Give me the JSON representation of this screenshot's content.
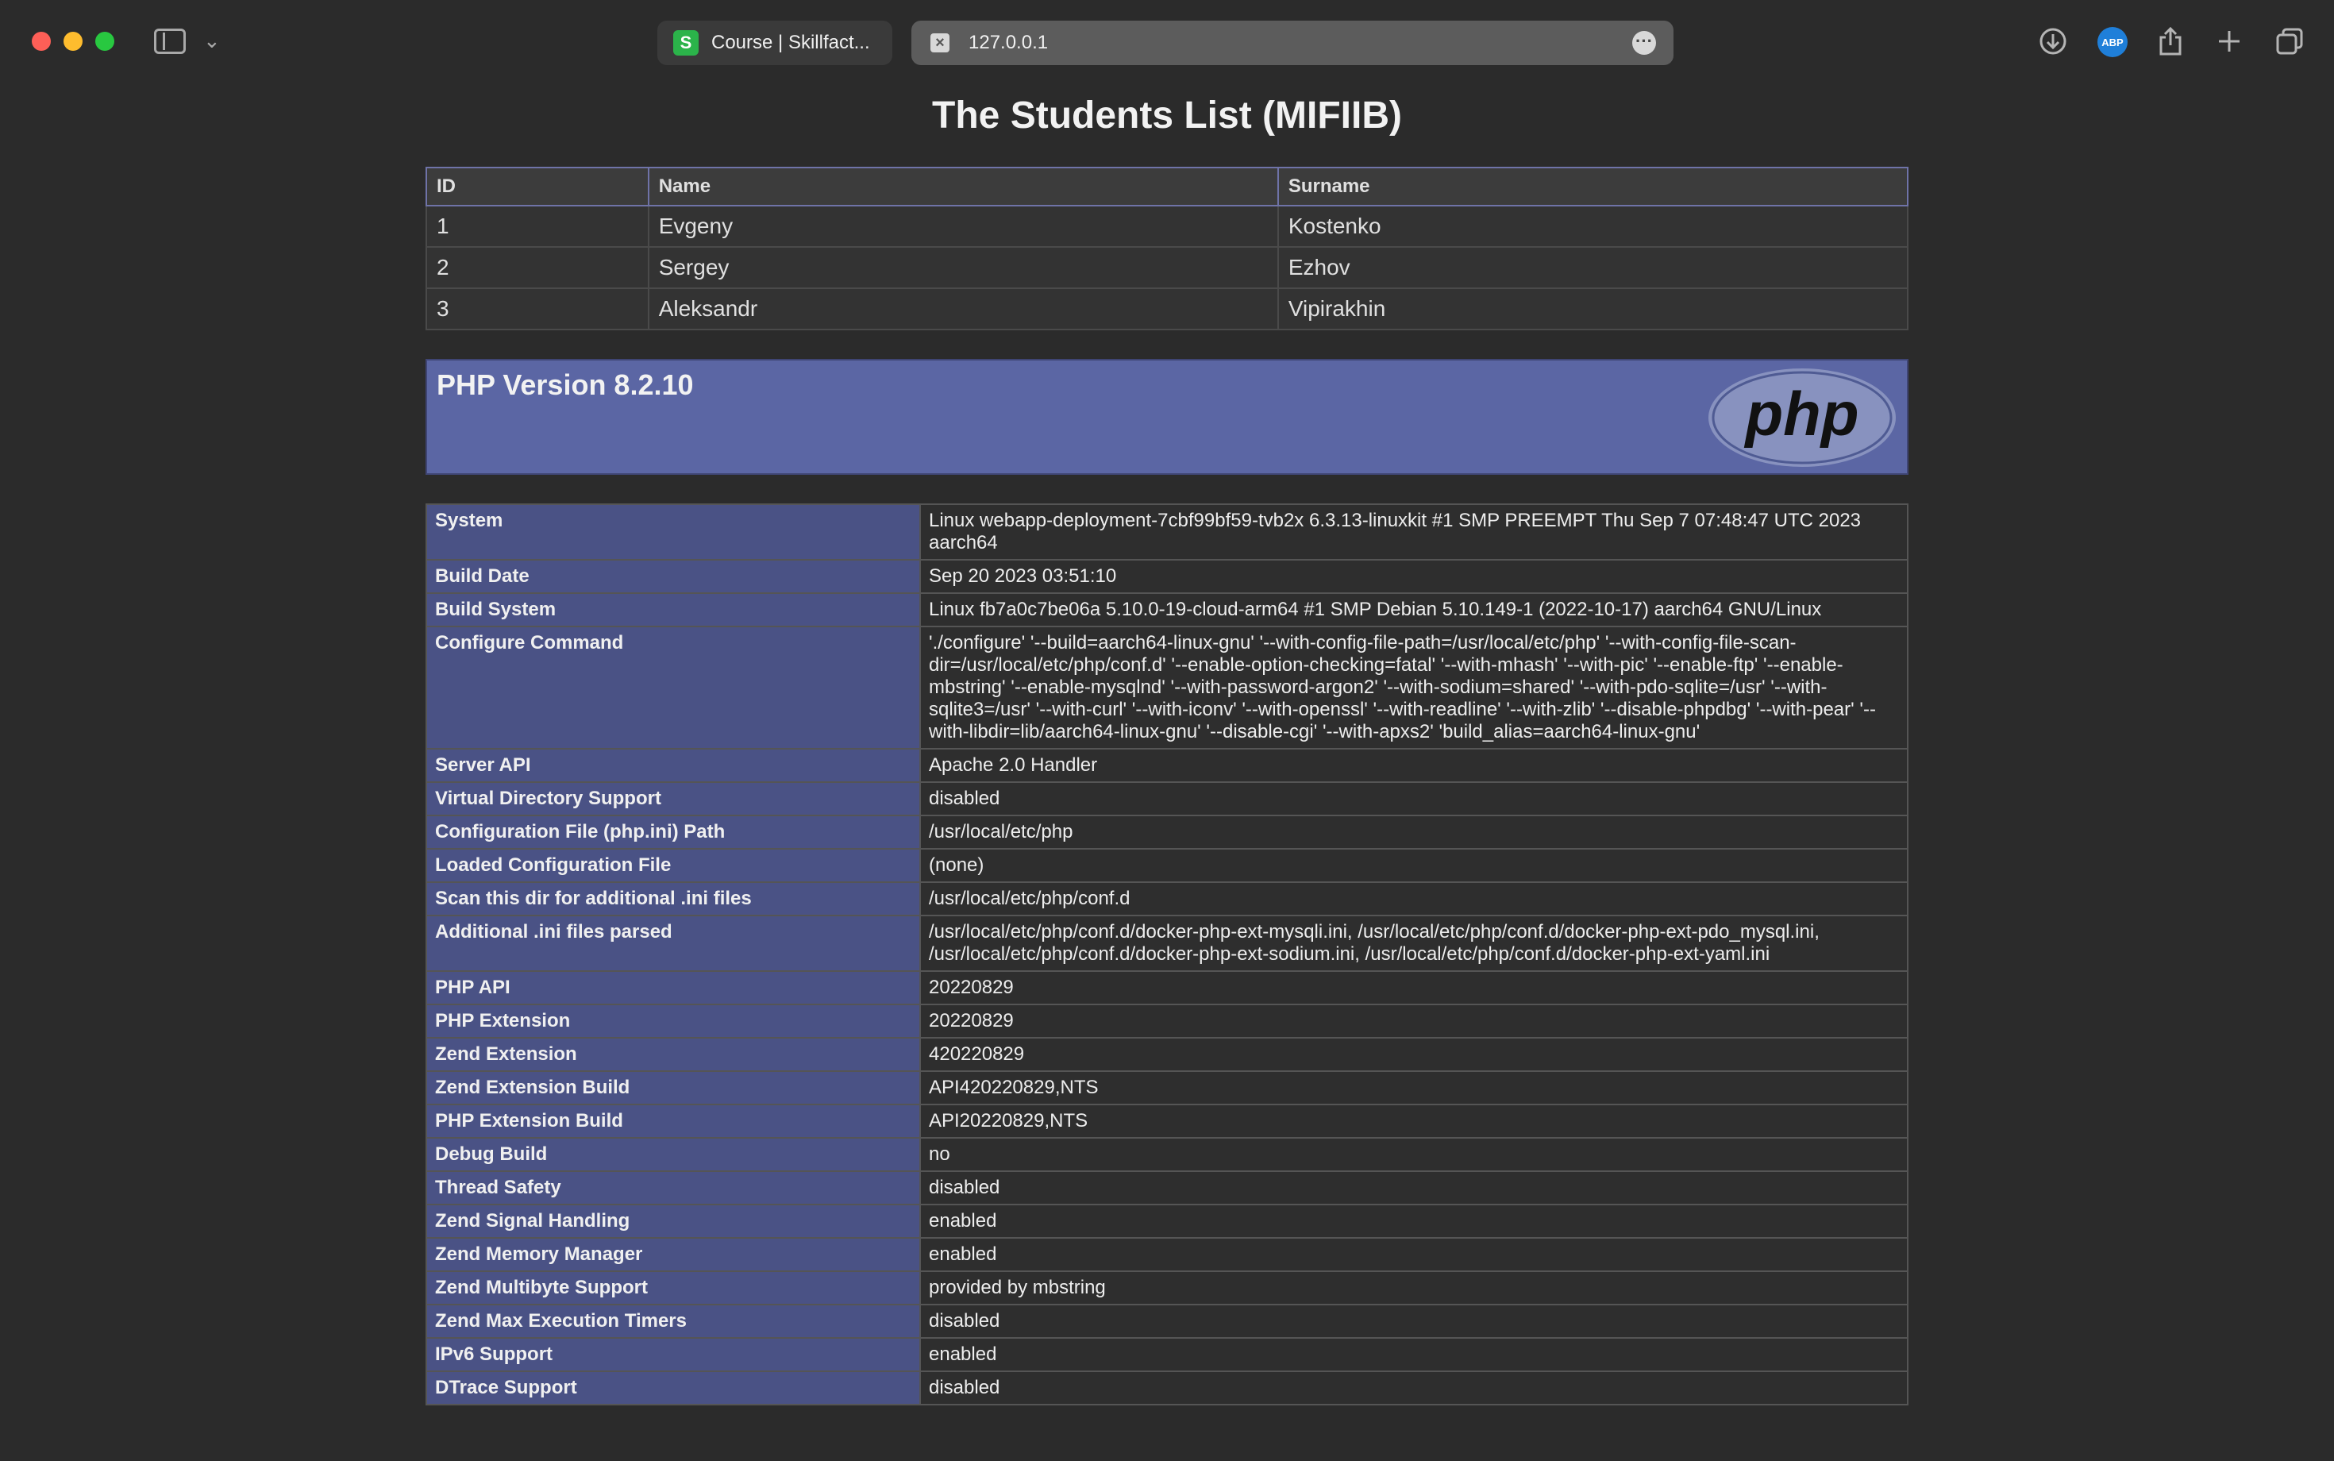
{
  "browser": {
    "tabs": [
      {
        "label": "Course | Skillfact...",
        "favicon": "skillfactory-icon"
      },
      {
        "label": "127.0.0.1",
        "favicon": "page-icon"
      }
    ],
    "toolbar_icons": [
      "download-icon",
      "adblock-icon",
      "share-icon",
      "new-tab-icon",
      "tab-overview-icon"
    ],
    "adblock_label": "ABP"
  },
  "page": {
    "title": "The Students List (MIFIIB)"
  },
  "students": {
    "headers": [
      "ID",
      "Name",
      "Surname"
    ],
    "rows": [
      [
        "1",
        "Evgeny",
        "Kostenko"
      ],
      [
        "2",
        "Sergey",
        "Ezhov"
      ],
      [
        "3",
        "Aleksandr",
        "Vipirakhin"
      ]
    ]
  },
  "phpinfo": {
    "version": "PHP Version 8.2.10",
    "logo_text": "php",
    "rows": [
      [
        "System",
        "Linux webapp-deployment-7cbf99bf59-tvb2x 6.3.13-linuxkit #1 SMP PREEMPT Thu Sep 7 07:48:47 UTC 2023 aarch64"
      ],
      [
        "Build Date",
        "Sep 20 2023 03:51:10"
      ],
      [
        "Build System",
        "Linux fb7a0c7be06a 5.10.0-19-cloud-arm64 #1 SMP Debian 5.10.149-1 (2022-10-17) aarch64 GNU/Linux"
      ],
      [
        "Configure Command",
        "'./configure' '--build=aarch64-linux-gnu' '--with-config-file-path=/usr/local/etc/php' '--with-config-file-scan-dir=/usr/local/etc/php/conf.d' '--enable-option-checking=fatal' '--with-mhash' '--with-pic' '--enable-ftp' '--enable-mbstring' '--enable-mysqlnd' '--with-password-argon2' '--with-sodium=shared' '--with-pdo-sqlite=/usr' '--with-sqlite3=/usr' '--with-curl' '--with-iconv' '--with-openssl' '--with-readline' '--with-zlib' '--disable-phpdbg' '--with-pear' '--with-libdir=lib/aarch64-linux-gnu' '--disable-cgi' '--with-apxs2' 'build_alias=aarch64-linux-gnu'"
      ],
      [
        "Server API",
        "Apache 2.0 Handler"
      ],
      [
        "Virtual Directory Support",
        "disabled"
      ],
      [
        "Configuration File (php.ini) Path",
        "/usr/local/etc/php"
      ],
      [
        "Loaded Configuration File",
        "(none)"
      ],
      [
        "Scan this dir for additional .ini files",
        "/usr/local/etc/php/conf.d"
      ],
      [
        "Additional .ini files parsed",
        "/usr/local/etc/php/conf.d/docker-php-ext-mysqli.ini, /usr/local/etc/php/conf.d/docker-php-ext-pdo_mysql.ini, /usr/local/etc/php/conf.d/docker-php-ext-sodium.ini, /usr/local/etc/php/conf.d/docker-php-ext-yaml.ini"
      ],
      [
        "PHP API",
        "20220829"
      ],
      [
        "PHP Extension",
        "20220829"
      ],
      [
        "Zend Extension",
        "420220829"
      ],
      [
        "Zend Extension Build",
        "API420220829,NTS"
      ],
      [
        "PHP Extension Build",
        "API20220829,NTS"
      ],
      [
        "Debug Build",
        "no"
      ],
      [
        "Thread Safety",
        "disabled"
      ],
      [
        "Zend Signal Handling",
        "enabled"
      ],
      [
        "Zend Memory Manager",
        "enabled"
      ],
      [
        "Zend Multibyte Support",
        "provided by mbstring"
      ],
      [
        "Zend Max Execution Timers",
        "disabled"
      ],
      [
        "IPv6 Support",
        "enabled"
      ],
      [
        "DTrace Support",
        "disabled"
      ]
    ]
  },
  "colors": {
    "header_blue": "#5b66a4",
    "label_blue": "#4a5285",
    "background": "#2b2b2b"
  }
}
